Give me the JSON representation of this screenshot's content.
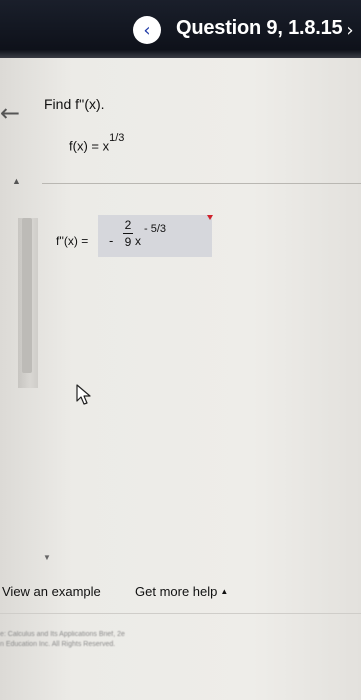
{
  "header": {
    "title": "Question 9, 1.8.15",
    "prev_icon": "chevron-left-icon",
    "prev_glyph": "‹",
    "next_icon": "chevron-right-icon",
    "next_glyph": "›"
  },
  "colors": {
    "header_bg": "#131722",
    "prev_button_bg": "#ffffff",
    "prev_button_fg": "#1f3aa8",
    "answer_box_bg": "#d6d7dc",
    "answer_marker": "#d0212b"
  },
  "question": {
    "back_glyph": "←",
    "prompt": "Find f''(x).",
    "given_fx": "f(x) = x",
    "given_exponent": "1/3",
    "collapse_glyph": "▲"
  },
  "answer": {
    "label": "f''(x) =",
    "sign": "-",
    "numerator": "2",
    "denominator": "9",
    "variable": "x",
    "exponent": "- 5/3"
  },
  "scroll": {
    "down_glyph": "▼"
  },
  "footer": {
    "view_example": "View an example",
    "get_more_help": "Get more help",
    "help_caret": "▲",
    "copyright_line1": "e: Calculus and Its Applications Brief, 2e",
    "copyright_line2": "n Education Inc. All Rights Reserved."
  }
}
